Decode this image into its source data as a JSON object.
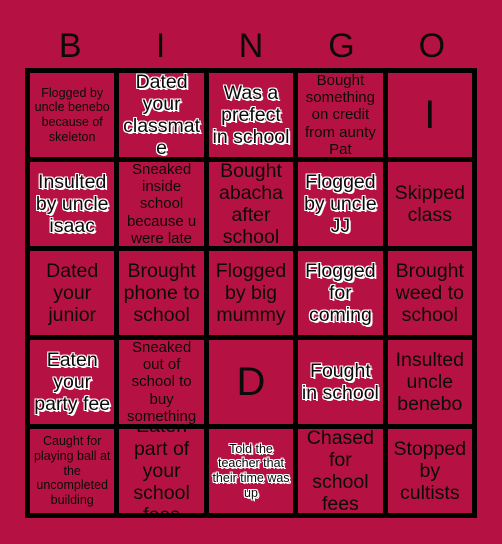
{
  "card": {
    "title_letters": [
      "B",
      "I",
      "N",
      "G",
      "O"
    ],
    "background_color": "#b51243",
    "border_color": "#000000",
    "text_color": "#0b0b0b",
    "outline_color": "#ffffff"
  },
  "rows": [
    {
      "cells": [
        {
          "text": "Flogged by uncle benebo because of skeleton",
          "style": "plain",
          "size": "sm"
        },
        {
          "text": "Dated your classmate",
          "style": "outlined",
          "size": "lg"
        },
        {
          "text": "Was a prefect in school",
          "style": "outlined",
          "size": "lg"
        },
        {
          "text": "Bought something on credit from aunty Pat",
          "style": "plain",
          "size": "md"
        },
        {
          "text": "I",
          "style": "plain",
          "size": "xl"
        }
      ]
    },
    {
      "cells": [
        {
          "text": "Insulted by uncle isaac",
          "style": "outlined",
          "size": "lg"
        },
        {
          "text": "Sneaked inside school because u were late",
          "style": "plain",
          "size": "md"
        },
        {
          "text": "Bought abacha after school",
          "style": "plain",
          "size": "lg"
        },
        {
          "text": "Flogged by uncle JJ",
          "style": "outlined",
          "size": "lg"
        },
        {
          "text": "Skipped class",
          "style": "plain",
          "size": "lg"
        }
      ]
    },
    {
      "cells": [
        {
          "text": "Dated your junior",
          "style": "plain",
          "size": "lg"
        },
        {
          "text": "Brought phone to school",
          "style": "plain",
          "size": "lg"
        },
        {
          "text": "Flogged by big mummy",
          "style": "plain",
          "size": "lg"
        },
        {
          "text": "Flogged for coming",
          "style": "outlined",
          "size": "lg"
        },
        {
          "text": "Brought weed to school",
          "style": "plain",
          "size": "lg"
        }
      ]
    },
    {
      "cells": [
        {
          "text": "Eaten your party fee",
          "style": "outlined",
          "size": "lg"
        },
        {
          "text": "Sneaked out of school to buy something",
          "style": "plain",
          "size": "md"
        },
        {
          "text": "D",
          "style": "plain",
          "size": "xl"
        },
        {
          "text": "Fought in school",
          "style": "outlined",
          "size": "lg"
        },
        {
          "text": "Insulted uncle benebo",
          "style": "plain",
          "size": "lg"
        }
      ]
    },
    {
      "cells": [
        {
          "text": "Caught for playing ball at the uncompleted building",
          "style": "plain",
          "size": "sm"
        },
        {
          "text": "Eaten part of your school fees",
          "style": "plain",
          "size": "lg"
        },
        {
          "text": "Told the teacher that their time was up",
          "style": "outlined",
          "size": "sm"
        },
        {
          "text": "Chased for school fees",
          "style": "plain",
          "size": "lg"
        },
        {
          "text": "Stopped by cultists",
          "style": "plain",
          "size": "lg"
        }
      ]
    }
  ]
}
